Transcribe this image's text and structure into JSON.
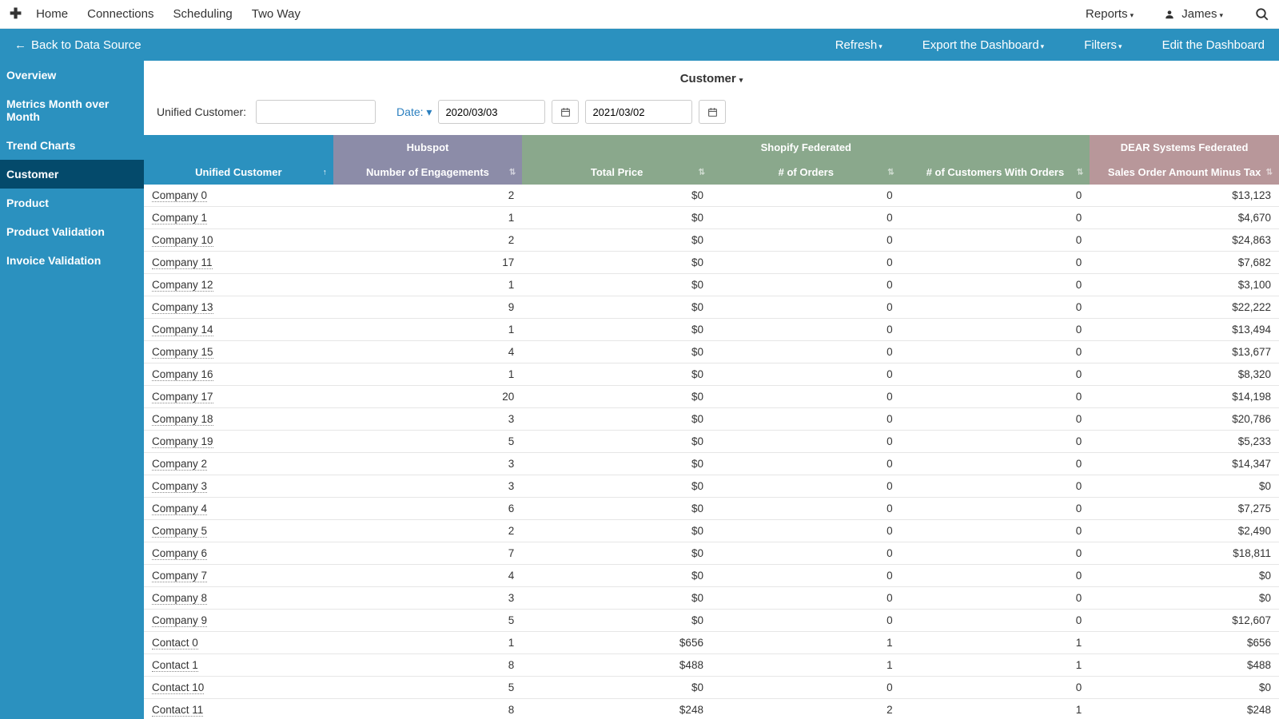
{
  "topnav": {
    "items": [
      "Home",
      "Connections",
      "Scheduling",
      "Two Way"
    ],
    "reports": "Reports",
    "user": "James"
  },
  "subbar": {
    "back": "Back to Data Source",
    "actions": [
      "Refresh",
      "Export the Dashboard",
      "Filters",
      "Edit the Dashboard"
    ]
  },
  "sidebar": {
    "items": [
      "Overview",
      "Metrics Month over Month",
      "Trend Charts",
      "Customer",
      "Product",
      "Product Validation",
      "Invoice Validation"
    ],
    "activeIndex": 3
  },
  "page": {
    "title": "Customer"
  },
  "filters": {
    "unifiedLabel": "Unified Customer:",
    "unifiedValue": "",
    "dateLabel": "Date:",
    "dateFrom": "2020/03/03",
    "dateTo": "2021/03/02"
  },
  "table": {
    "groups": [
      {
        "label": "",
        "cls": "g1",
        "span": 1
      },
      {
        "label": "Hubspot",
        "cls": "g2",
        "span": 1
      },
      {
        "label": "Shopify Federated",
        "cls": "g3",
        "span": 3
      },
      {
        "label": "DEAR Systems Federated",
        "cls": "g4",
        "span": 1
      }
    ],
    "columns": [
      {
        "label": "Unified Customer",
        "cls": "h1",
        "sort": "asc"
      },
      {
        "label": "Number of Engagements",
        "cls": "h2"
      },
      {
        "label": "Total Price",
        "cls": "h3"
      },
      {
        "label": "# of Orders",
        "cls": "h3"
      },
      {
        "label": "# of Customers With Orders",
        "cls": "h3"
      },
      {
        "label": "Sales Order Amount Minus Tax",
        "cls": "h4"
      }
    ],
    "rows": [
      {
        "name": "Company 0",
        "ne": "2",
        "tp": "$0",
        "no": "0",
        "nc": "0",
        "so": "$13,123"
      },
      {
        "name": "Company 1",
        "ne": "1",
        "tp": "$0",
        "no": "0",
        "nc": "0",
        "so": "$4,670"
      },
      {
        "name": "Company 10",
        "ne": "2",
        "tp": "$0",
        "no": "0",
        "nc": "0",
        "so": "$24,863"
      },
      {
        "name": "Company 11",
        "ne": "17",
        "tp": "$0",
        "no": "0",
        "nc": "0",
        "so": "$7,682"
      },
      {
        "name": "Company 12",
        "ne": "1",
        "tp": "$0",
        "no": "0",
        "nc": "0",
        "so": "$3,100"
      },
      {
        "name": "Company 13",
        "ne": "9",
        "tp": "$0",
        "no": "0",
        "nc": "0",
        "so": "$22,222"
      },
      {
        "name": "Company 14",
        "ne": "1",
        "tp": "$0",
        "no": "0",
        "nc": "0",
        "so": "$13,494"
      },
      {
        "name": "Company 15",
        "ne": "4",
        "tp": "$0",
        "no": "0",
        "nc": "0",
        "so": "$13,677"
      },
      {
        "name": "Company 16",
        "ne": "1",
        "tp": "$0",
        "no": "0",
        "nc": "0",
        "so": "$8,320"
      },
      {
        "name": "Company 17",
        "ne": "20",
        "tp": "$0",
        "no": "0",
        "nc": "0",
        "so": "$14,198"
      },
      {
        "name": "Company 18",
        "ne": "3",
        "tp": "$0",
        "no": "0",
        "nc": "0",
        "so": "$20,786"
      },
      {
        "name": "Company 19",
        "ne": "5",
        "tp": "$0",
        "no": "0",
        "nc": "0",
        "so": "$5,233"
      },
      {
        "name": "Company 2",
        "ne": "3",
        "tp": "$0",
        "no": "0",
        "nc": "0",
        "so": "$14,347"
      },
      {
        "name": "Company 3",
        "ne": "3",
        "tp": "$0",
        "no": "0",
        "nc": "0",
        "so": "$0"
      },
      {
        "name": "Company 4",
        "ne": "6",
        "tp": "$0",
        "no": "0",
        "nc": "0",
        "so": "$7,275"
      },
      {
        "name": "Company 5",
        "ne": "2",
        "tp": "$0",
        "no": "0",
        "nc": "0",
        "so": "$2,490"
      },
      {
        "name": "Company 6",
        "ne": "7",
        "tp": "$0",
        "no": "0",
        "nc": "0",
        "so": "$18,811"
      },
      {
        "name": "Company 7",
        "ne": "4",
        "tp": "$0",
        "no": "0",
        "nc": "0",
        "so": "$0"
      },
      {
        "name": "Company 8",
        "ne": "3",
        "tp": "$0",
        "no": "0",
        "nc": "0",
        "so": "$0"
      },
      {
        "name": "Company 9",
        "ne": "5",
        "tp": "$0",
        "no": "0",
        "nc": "0",
        "so": "$12,607"
      },
      {
        "name": "Contact 0",
        "ne": "1",
        "tp": "$656",
        "no": "1",
        "nc": "1",
        "so": "$656"
      },
      {
        "name": "Contact 1",
        "ne": "8",
        "tp": "$488",
        "no": "1",
        "nc": "1",
        "so": "$488"
      },
      {
        "name": "Contact 10",
        "ne": "5",
        "tp": "$0",
        "no": "0",
        "nc": "0",
        "so": "$0"
      },
      {
        "name": "Contact 11",
        "ne": "8",
        "tp": "$248",
        "no": "2",
        "nc": "1",
        "so": "$248"
      }
    ]
  }
}
